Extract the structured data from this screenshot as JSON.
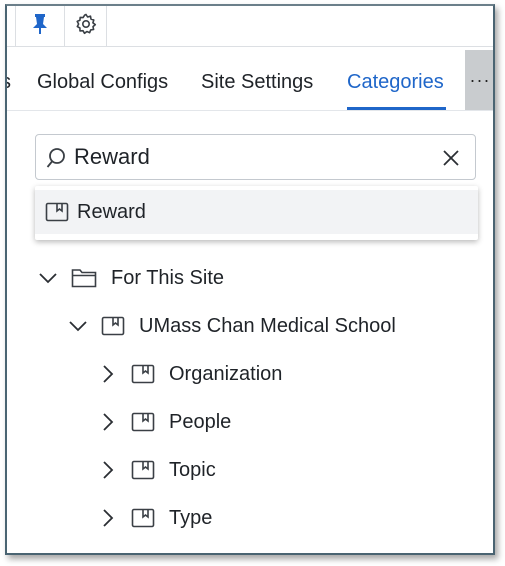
{
  "toolbar": {
    "pin_icon": "pin-icon",
    "settings_icon": "gear-icon"
  },
  "tabs": [
    {
      "label": "s",
      "active": false
    },
    {
      "label": "Global Configs",
      "active": false
    },
    {
      "label": "Site Settings",
      "active": false
    },
    {
      "label": "Categories",
      "active": true
    }
  ],
  "more_label": "···",
  "search": {
    "value": "Reward",
    "placeholder": ""
  },
  "dropdown": {
    "options": [
      {
        "label": "Reward"
      }
    ]
  },
  "tree": {
    "root": {
      "label": "For This Site",
      "expanded": true
    },
    "school": {
      "label": "UMass Chan Medical School",
      "expanded": true
    },
    "children": [
      {
        "label": "Organization"
      },
      {
        "label": "People"
      },
      {
        "label": "Topic"
      },
      {
        "label": "Type"
      }
    ]
  },
  "colors": {
    "accent": "#1f66c9",
    "pin": "#1f66c9",
    "text": "#1f2328"
  }
}
